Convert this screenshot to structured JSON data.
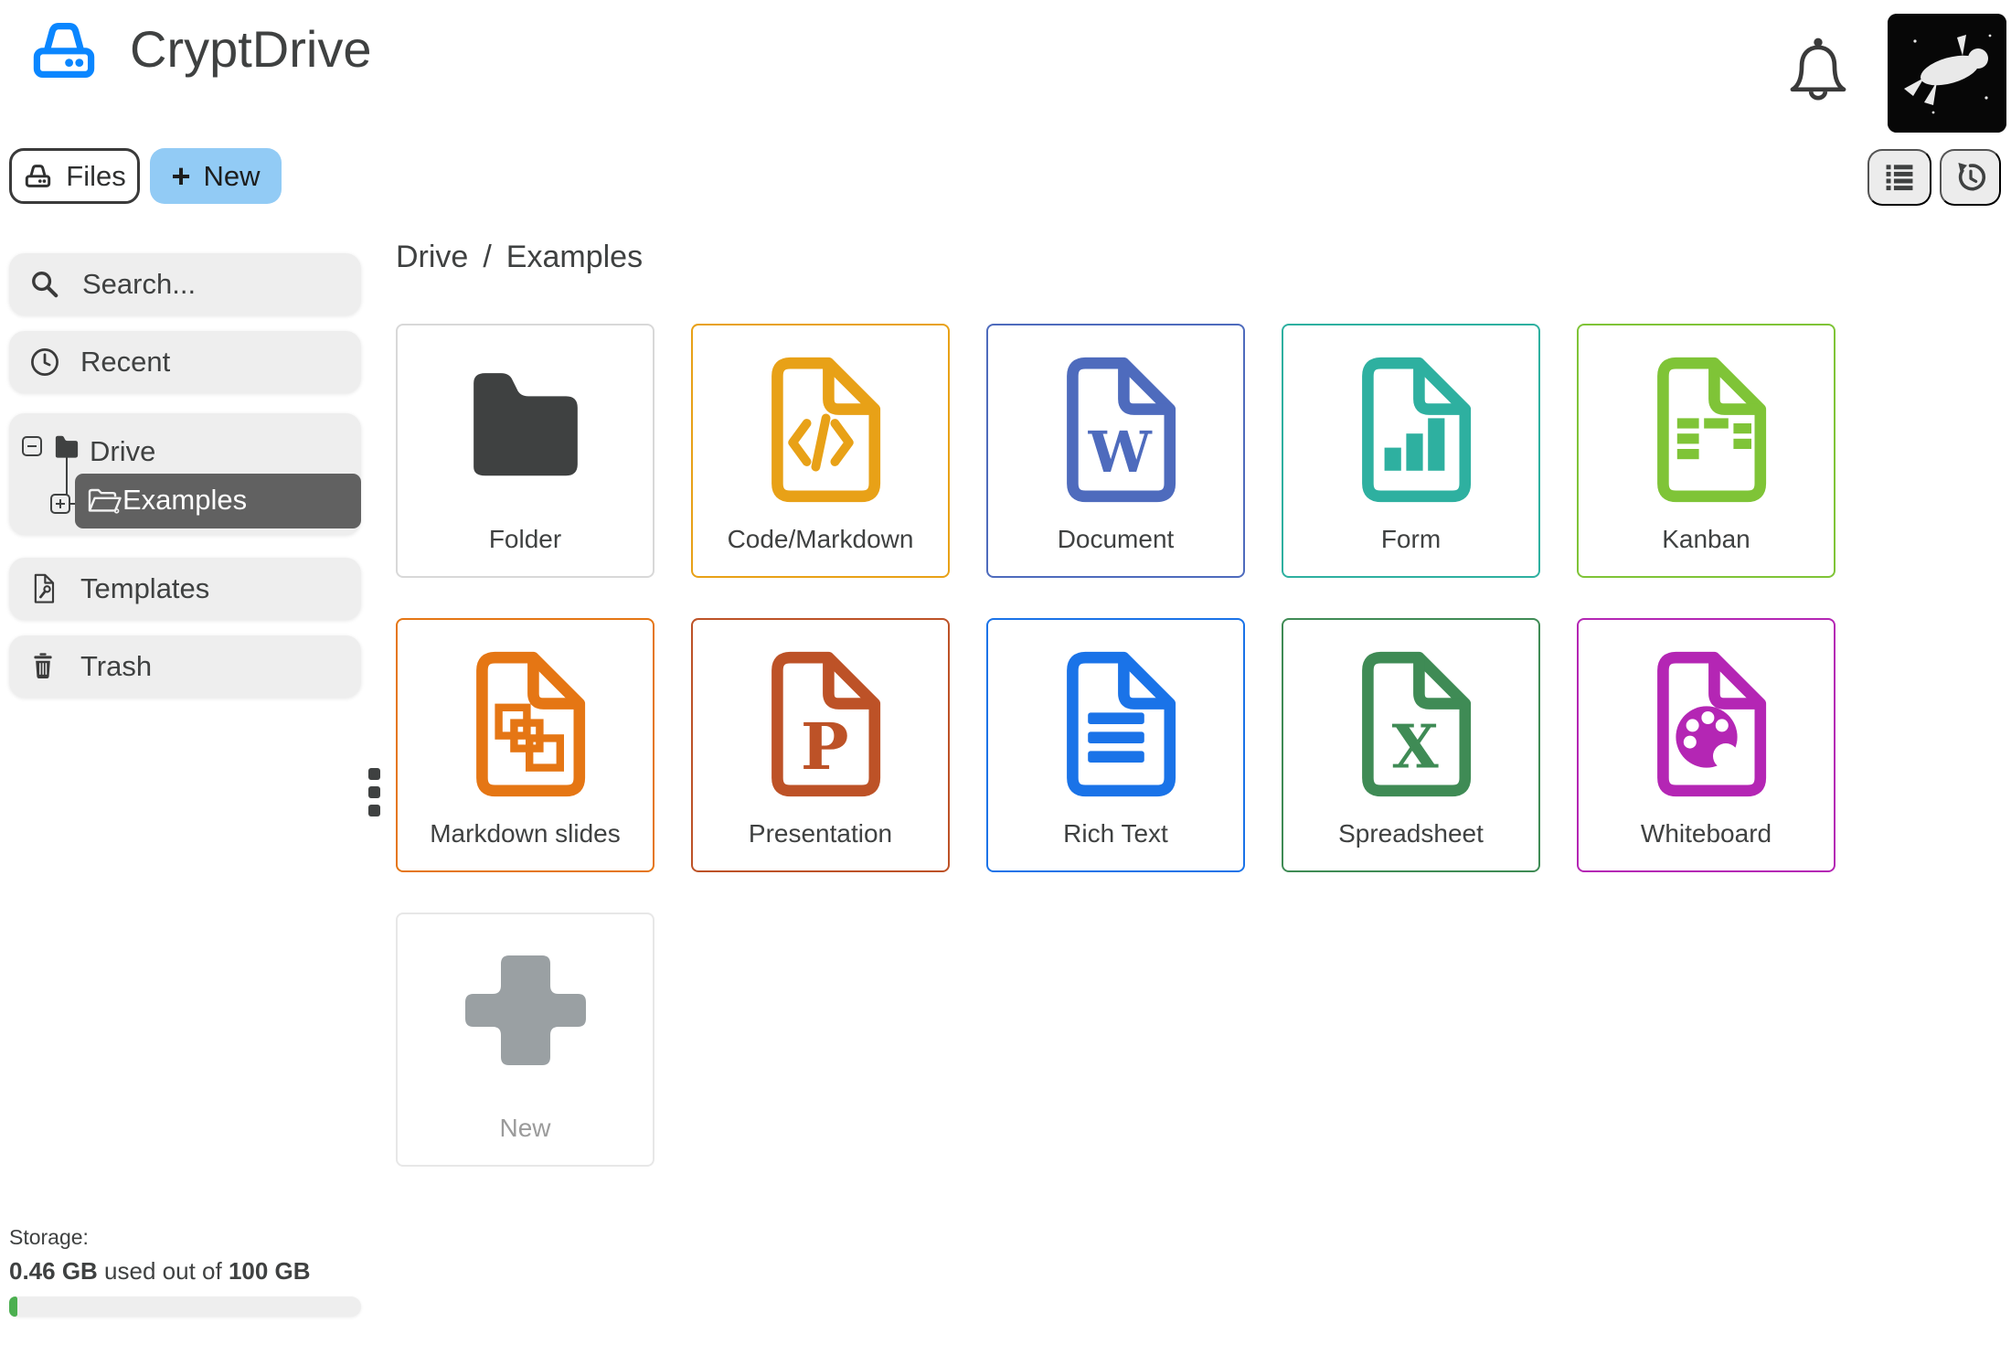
{
  "app": {
    "title": "CryptDrive",
    "logo_icon": "hard-drive-icon"
  },
  "topbar": {
    "notifications_icon": "bell-icon",
    "avatar_icon": "astronaut-avatar",
    "list_view_icon": "list-view-icon",
    "history_icon": "history-icon"
  },
  "toolbar": {
    "files_label": "Files",
    "files_icon": "hard-drive-icon",
    "new_label": "New",
    "new_plus": "+"
  },
  "sidebar": {
    "search_placeholder": "Search...",
    "search_icon": "search-icon",
    "recent_label": "Recent",
    "recent_icon": "clock-icon",
    "templates_label": "Templates",
    "templates_icon": "template-file-icon",
    "trash_label": "Trash",
    "trash_icon": "trash-icon",
    "tree": {
      "root_label": "Drive",
      "root_icon": "folder-closed-icon",
      "selected_label": "Examples",
      "selected_icon": "folder-open-icon"
    },
    "storage": {
      "label": "Storage:",
      "used": "0.46 GB",
      "infix": " used out of ",
      "total": "100 GB",
      "percent_used": 0.46
    }
  },
  "breadcrumb": {
    "root": "Drive",
    "separator": "/",
    "current": "Examples"
  },
  "cards": [
    {
      "label": "Folder",
      "glyph": "folder",
      "icon": "folder-icon",
      "color": "#3f4141",
      "border": "#d8d8d8"
    },
    {
      "label": "Code/Markdown",
      "glyph": "code",
      "icon": "code-file-icon",
      "color": "#e8a117"
    },
    {
      "label": "Document",
      "glyph": "document",
      "icon": "document-file-icon",
      "color": "#4e6bbd"
    },
    {
      "label": "Form",
      "glyph": "form",
      "icon": "form-file-icon",
      "color": "#2eb0a0"
    },
    {
      "label": "Kanban",
      "glyph": "kanban",
      "icon": "kanban-file-icon",
      "color": "#7fc437"
    },
    {
      "label": "Markdown slides",
      "glyph": "slides",
      "icon": "slides-file-icon",
      "color": "#e57614"
    },
    {
      "label": "Presentation",
      "glyph": "presentation",
      "icon": "presentation-file-icon",
      "color": "#bd5227"
    },
    {
      "label": "Rich Text",
      "glyph": "richtext",
      "icon": "richtext-file-icon",
      "color": "#1a73e8"
    },
    {
      "label": "Spreadsheet",
      "glyph": "spreadsheet",
      "icon": "spreadsheet-file-icon",
      "color": "#3f8b55"
    },
    {
      "label": "Whiteboard",
      "glyph": "whiteboard",
      "icon": "whiteboard-file-icon",
      "color": "#b426b4"
    },
    {
      "label": "New",
      "glyph": "plus",
      "icon": "plus-icon",
      "color": "#9aa0a3",
      "border": "#e7e7e7",
      "label_color": "#9b9b9b",
      "muted": true
    }
  ],
  "colors": {
    "accent_blue": "#0a86ff",
    "new_button_bg": "#92cbf5",
    "sidebar_item_bg": "#eeeeee",
    "selected_tree_bg": "#616161",
    "text": "#3f4141",
    "storage_bar_fill": "#4caf50"
  }
}
